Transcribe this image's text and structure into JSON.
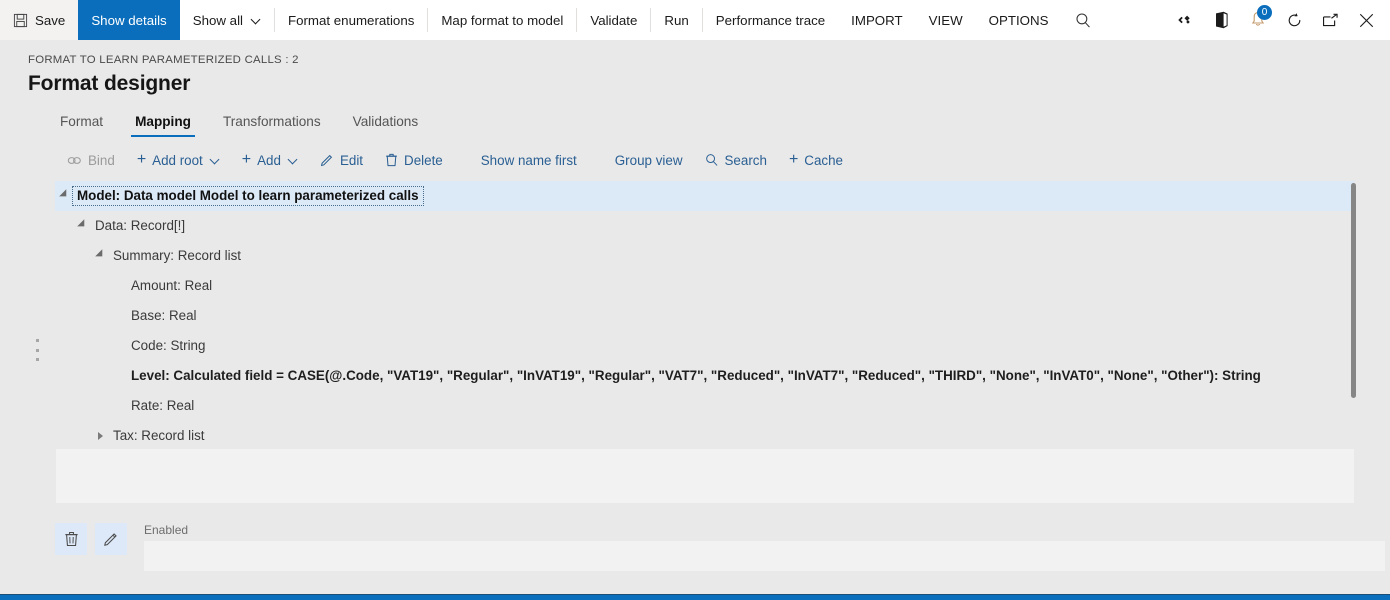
{
  "topbar": {
    "items": [
      {
        "label": "Save",
        "icon": "save-icon",
        "active": false,
        "name": "save"
      },
      {
        "label": "Show details",
        "icon": null,
        "active": true,
        "name": "show-details"
      },
      {
        "label": "Show all",
        "icon": null,
        "caret": true,
        "active": false,
        "name": "show-all"
      },
      {
        "label": "Format enumerations",
        "icon": null,
        "active": false,
        "name": "format-enumerations"
      },
      {
        "label": "Map format to model",
        "icon": null,
        "active": false,
        "name": "map-format-to-model"
      },
      {
        "label": "Validate",
        "icon": null,
        "active": false,
        "name": "validate"
      },
      {
        "label": "Run",
        "icon": null,
        "active": false,
        "name": "run"
      },
      {
        "label": "Performance trace",
        "icon": null,
        "active": false,
        "name": "performance-trace"
      },
      {
        "label": "IMPORT",
        "icon": null,
        "active": false,
        "name": "import"
      },
      {
        "label": "VIEW",
        "icon": null,
        "active": false,
        "name": "view"
      },
      {
        "label": "OPTIONS",
        "icon": null,
        "active": false,
        "name": "options"
      }
    ],
    "search_icon": "search-icon",
    "right_icons": [
      {
        "name": "code-diamonds-icon"
      },
      {
        "name": "office-app-icon"
      },
      {
        "name": "notifications-bell-icon",
        "badge": "0"
      },
      {
        "name": "refresh-icon"
      },
      {
        "name": "popout-icon"
      },
      {
        "name": "close-icon"
      }
    ],
    "accent_color": "#0a6ebd"
  },
  "header": {
    "breadcrumb": "FORMAT TO LEARN PARAMETERIZED CALLS : 2",
    "title": "Format designer"
  },
  "tabs": [
    {
      "label": "Format",
      "selected": false
    },
    {
      "label": "Mapping",
      "selected": true
    },
    {
      "label": "Transformations",
      "selected": false
    },
    {
      "label": "Validations",
      "selected": false
    }
  ],
  "actionbar": [
    {
      "label": "Bind",
      "icon": "link-icon",
      "disabled": true,
      "name": "bind"
    },
    {
      "label": "Add root",
      "icon": "plus-icon",
      "caret": true,
      "disabled": false,
      "name": "add-root"
    },
    {
      "label": "Add",
      "icon": "plus-icon",
      "caret": true,
      "disabled": false,
      "name": "add"
    },
    {
      "label": "Edit",
      "icon": "pencil-icon",
      "disabled": false,
      "name": "edit"
    },
    {
      "label": "Delete",
      "icon": "trash-icon",
      "disabled": false,
      "name": "delete"
    },
    {
      "label": "Show name first",
      "icon": null,
      "disabled": false,
      "gapBefore": true,
      "name": "show-name-first"
    },
    {
      "label": "Group view",
      "icon": null,
      "disabled": false,
      "gapBefore": true,
      "name": "group-view"
    },
    {
      "label": "Search",
      "icon": "search-icon",
      "disabled": false,
      "name": "search"
    },
    {
      "label": "Cache",
      "icon": "plus-icon",
      "disabled": false,
      "name": "cache"
    }
  ],
  "tree": {
    "rows": [
      {
        "label": "Model: Data model Model to learn parameterized calls",
        "indent": 0,
        "toggle": "expanded",
        "selected": true,
        "bold": true
      },
      {
        "label": "Data: Record[!]",
        "indent": 1,
        "toggle": "expanded",
        "selected": false,
        "bold": false
      },
      {
        "label": "Summary: Record list",
        "indent": 2,
        "toggle": "expanded",
        "selected": false,
        "bold": false
      },
      {
        "label": "Amount: Real",
        "indent": 3,
        "toggle": "none",
        "selected": false,
        "bold": false
      },
      {
        "label": "Base: Real",
        "indent": 3,
        "toggle": "none",
        "selected": false,
        "bold": false
      },
      {
        "label": "Code: String",
        "indent": 3,
        "toggle": "none",
        "selected": false,
        "bold": false
      },
      {
        "label": "Level: Calculated field = CASE(@.Code, \"VAT19\", \"Regular\", \"InVAT19\", \"Regular\", \"VAT7\", \"Reduced\", \"InVAT7\", \"Reduced\", \"THIRD\", \"None\", \"InVAT0\", \"None\", \"Other\"): String",
        "indent": 3,
        "toggle": "none",
        "selected": false,
        "bold": true
      },
      {
        "label": "Rate: Real",
        "indent": 3,
        "toggle": "none",
        "selected": false,
        "bold": false
      },
      {
        "label": "Tax: Record list",
        "indent": 2,
        "toggle": "collapsed",
        "selected": false,
        "bold": false
      }
    ]
  },
  "footer": {
    "delete_icon": "trash-icon",
    "edit_icon": "pencil-icon",
    "field": {
      "label": "Enabled",
      "value": "",
      "placeholder": ""
    }
  }
}
